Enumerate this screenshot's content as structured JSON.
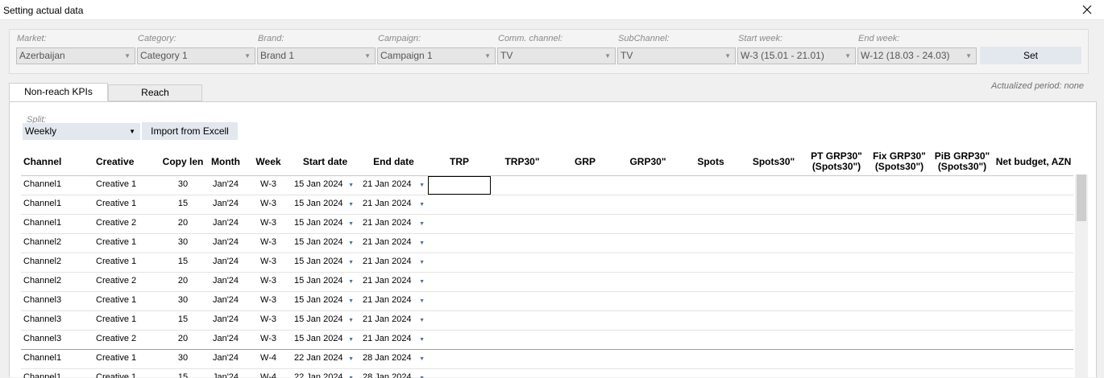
{
  "window": {
    "title": "Setting actual data"
  },
  "filters": [
    {
      "label": "Market:",
      "value": "Azerbaijan"
    },
    {
      "label": "Category:",
      "value": "Category 1"
    },
    {
      "label": "Brand:",
      "value": "Brand 1"
    },
    {
      "label": "Campaign:",
      "value": "Campaign 1"
    },
    {
      "label": "Comm. channel:",
      "value": "TV"
    },
    {
      "label": "SubChannel:",
      "value": "TV"
    },
    {
      "label": "Start week:",
      "value": "W-3 (15.01 - 21.01)"
    },
    {
      "label": "End week:",
      "value": "W-12 (18.03 - 24.03)"
    }
  ],
  "set_button": "Set",
  "tabs": [
    {
      "label": "Non-reach KPIs",
      "active": true
    },
    {
      "label": "Reach",
      "active": false
    }
  ],
  "actualized_period": "Actualized period: none",
  "split": {
    "label": "Split:",
    "value": "Weekly"
  },
  "import_button": "Import from Excell",
  "table": {
    "headers": {
      "channel": "Channel",
      "creative": "Creative",
      "copy_len": "Copy len",
      "month": "Month",
      "week": "Week",
      "start_date": "Start date",
      "end_date": "End date",
      "trp": "TRP",
      "trp30": "TRP30\"",
      "grp": "GRP",
      "grp30": "GRP30\"",
      "spots": "Spots",
      "spots30": "Spots30\"",
      "pt_grp30": "PT GRP30\"",
      "pt_grp30_sub": "(Spots30\")",
      "fix_grp30": "Fix GRP30\"",
      "fix_grp30_sub": "(Spots30\")",
      "pib_grp30": "PiB GRP30\"",
      "pib_grp30_sub": "(Spots30\")",
      "net_budget": "Net budget, AZN"
    },
    "rows": [
      {
        "channel": "Channel1",
        "creative": "Creative 1",
        "copy_len": "30",
        "month": "Jan'24",
        "week": "W-3",
        "start": "15 Jan 2024",
        "end": "21 Jan 2024"
      },
      {
        "channel": "Channel1",
        "creative": "Creative 1",
        "copy_len": "15",
        "month": "Jan'24",
        "week": "W-3",
        "start": "15 Jan 2024",
        "end": "21 Jan 2024"
      },
      {
        "channel": "Channel1",
        "creative": "Creative 2",
        "copy_len": "20",
        "month": "Jan'24",
        "week": "W-3",
        "start": "15 Jan 2024",
        "end": "21 Jan 2024"
      },
      {
        "channel": "Channel2",
        "creative": "Creative 1",
        "copy_len": "30",
        "month": "Jan'24",
        "week": "W-3",
        "start": "15 Jan 2024",
        "end": "21 Jan 2024"
      },
      {
        "channel": "Channel2",
        "creative": "Creative 1",
        "copy_len": "15",
        "month": "Jan'24",
        "week": "W-3",
        "start": "15 Jan 2024",
        "end": "21 Jan 2024"
      },
      {
        "channel": "Channel2",
        "creative": "Creative 2",
        "copy_len": "20",
        "month": "Jan'24",
        "week": "W-3",
        "start": "15 Jan 2024",
        "end": "21 Jan 2024"
      },
      {
        "channel": "Channel3",
        "creative": "Creative 1",
        "copy_len": "30",
        "month": "Jan'24",
        "week": "W-3",
        "start": "15 Jan 2024",
        "end": "21 Jan 2024"
      },
      {
        "channel": "Channel3",
        "creative": "Creative 1",
        "copy_len": "15",
        "month": "Jan'24",
        "week": "W-3",
        "start": "15 Jan 2024",
        "end": "21 Jan 2024"
      },
      {
        "channel": "Channel3",
        "creative": "Creative 2",
        "copy_len": "20",
        "month": "Jan'24",
        "week": "W-3",
        "start": "15 Jan 2024",
        "end": "21 Jan 2024"
      },
      {
        "channel": "Channel1",
        "creative": "Creative 1",
        "copy_len": "30",
        "month": "Jan'24",
        "week": "W-4",
        "start": "22 Jan 2024",
        "end": "28 Jan 2024"
      },
      {
        "channel": "Channel1",
        "creative": "Creative 1",
        "copy_len": "15",
        "month": "Jan'24",
        "week": "W-4",
        "start": "22 Jan 2024",
        "end": "28 Jan 2024"
      }
    ]
  }
}
